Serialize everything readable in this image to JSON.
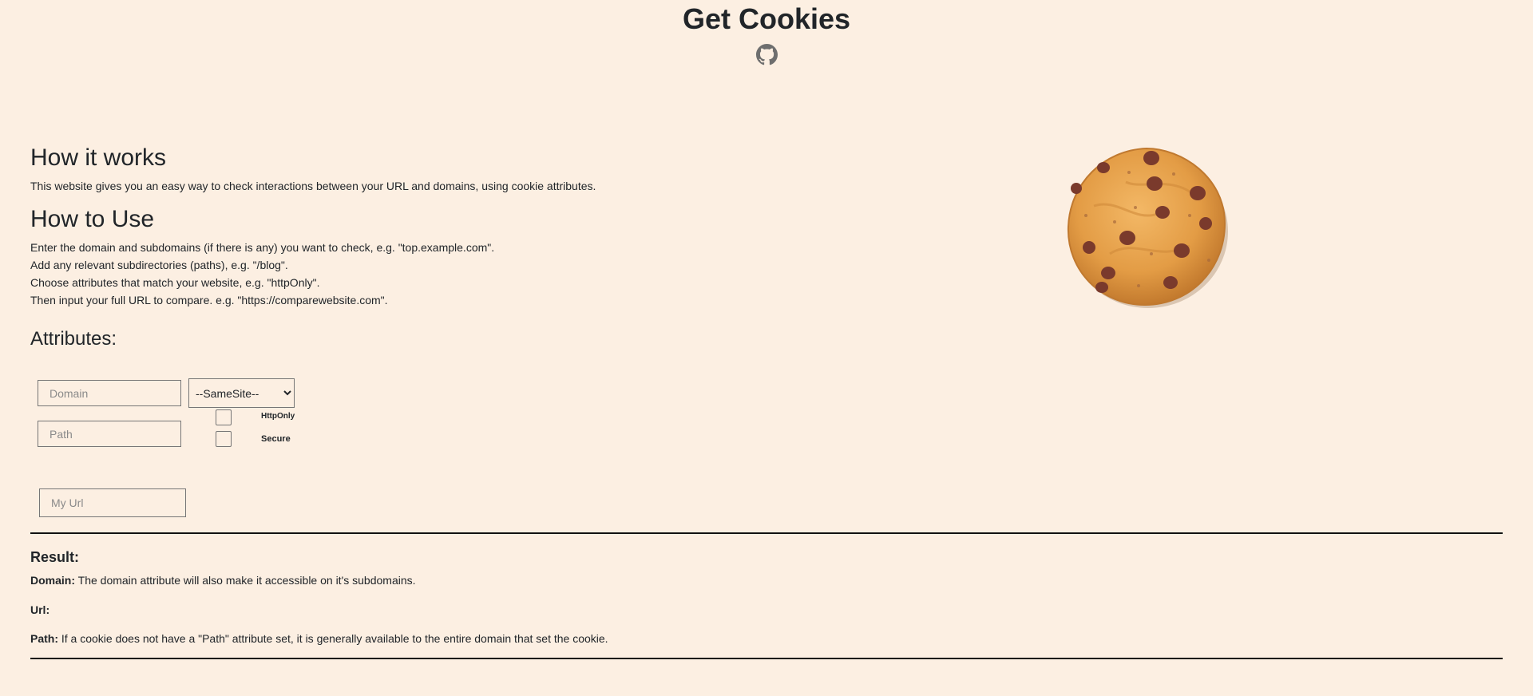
{
  "header": {
    "title": "Get Cookies",
    "github_icon": "github-icon"
  },
  "how_it_works": {
    "heading": "How it works",
    "text": "This website gives you an easy way to check interactions between your URL and domains, using cookie attributes."
  },
  "how_to_use": {
    "heading": "How to Use",
    "lines": [
      "Enter the domain and subdomains (if there is any) you want to check, e.g. \"top.example.com\".",
      "Add any relevant subdirectories (paths), e.g. \"/blog\".",
      "Choose attributes that match your website, e.g. \"httpOnly\".",
      "Then input your full URL to compare. e.g. \"https://comparewebsite.com\"."
    ]
  },
  "attributes": {
    "heading": "Attributes:",
    "domain_placeholder": "Domain",
    "path_placeholder": "Path",
    "samesite_selected": "--SameSite--",
    "httponly_label": "HttpOnly",
    "secure_label": "Secure",
    "url_placeholder": "My Url"
  },
  "result": {
    "heading": "Result:",
    "domain_label": "Domain:",
    "domain_text": "The domain attribute will also make it accessible on it's subdomains.",
    "url_label": "Url:",
    "url_text": "",
    "path_label": "Path:",
    "path_text": "If a cookie does not have a \"Path\" attribute set, it is generally available to the entire domain that set the cookie."
  },
  "colors": {
    "background": "#fcefe2",
    "text": "#212529",
    "cookie": "#e9a24d",
    "chocolate": "#7a3a2c"
  },
  "images": {
    "cookie": "cookie-image"
  }
}
